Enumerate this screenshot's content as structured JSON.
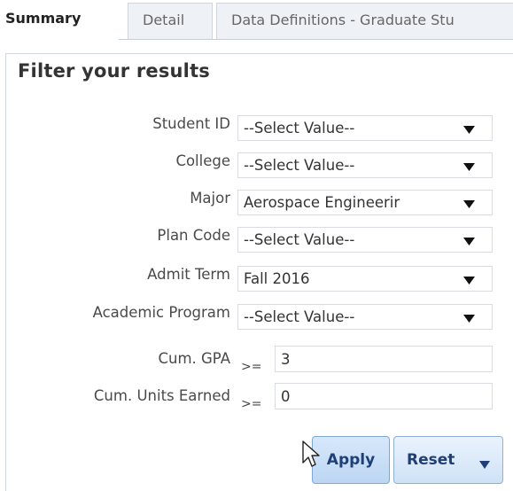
{
  "tabs": [
    {
      "label": "Summary",
      "active": true
    },
    {
      "label": "Detail",
      "active": false
    },
    {
      "label": "Data Definitions - Graduate Stu",
      "active": false
    }
  ],
  "filter": {
    "title": "Filter your results",
    "fields": [
      {
        "label": "Student ID",
        "value": "--Select Value--"
      },
      {
        "label": "College",
        "value": "--Select Value--"
      },
      {
        "label": "Major",
        "value": "Aerospace Engineerir"
      },
      {
        "label": "Plan Code",
        "value": "--Select Value--"
      },
      {
        "label": "Admit Term",
        "value": "Fall 2016"
      },
      {
        "label": "Academic Program",
        "value": "--Select Value--"
      }
    ],
    "gpa": {
      "label": "Cum. GPA",
      "operator": ">=",
      "value": "3"
    },
    "units": {
      "label": "Cum. Units Earned",
      "operator": ">=",
      "value": "0"
    }
  },
  "buttons": {
    "apply_label": "Apply",
    "reset_label": "Reset"
  },
  "icons": {
    "dropdown": "dropdown-arrow-icon",
    "cursor": "mouse-pointer-icon"
  },
  "colors": {
    "button_text": "#1f3f76",
    "button_border": "#8fb0d6",
    "tab_inactive_bg": "#eef2f6"
  }
}
